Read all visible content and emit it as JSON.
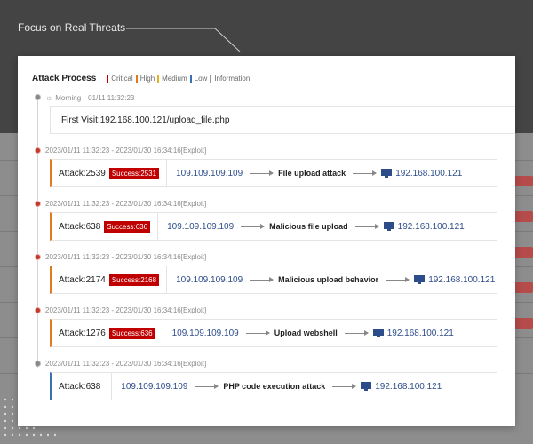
{
  "callout": {
    "text": "Focus on Real Threats"
  },
  "panel": {
    "title": "Attack Process",
    "legend": [
      {
        "label": "Critical",
        "color": "#c00000"
      },
      {
        "label": "High",
        "color": "#e07a1f"
      },
      {
        "label": "Medium",
        "color": "#e8b21f"
      },
      {
        "label": "Low",
        "color": "#3b6fb6"
      },
      {
        "label": "Information",
        "color": "#9a9a9a"
      }
    ]
  },
  "first_event": {
    "period": "Morning",
    "time": "01/11 11:32:23",
    "text": "First Visit:192.168.100.121/upload_file.php"
  },
  "events": [
    {
      "range": "2023/01/11 11:32:23 - 2023/01/30 16:34:16[Exploit]",
      "attack": "Attack:2539",
      "success": "Success:2531",
      "src_ip": "109.109.109.109",
      "name": "File upload attack",
      "dst_ip": "192.168.100.121",
      "level": "High"
    },
    {
      "range": "2023/01/11 11:32:23 - 2023/01/30 16:34:16[Exploit]",
      "attack": "Attack:638",
      "success": "Success:636",
      "src_ip": "109.109.109.109",
      "name": "Malicious file upload",
      "dst_ip": "192.168.100.121",
      "level": "High"
    },
    {
      "range": "2023/01/11 11:32:23 - 2023/01/30 16:34:16[Exploit]",
      "attack": "Attack:2174",
      "success": "Success:2168",
      "src_ip": "109.109.109.109",
      "name": "Malicious upload behavior",
      "dst_ip": "192.168.100.121",
      "level": "High"
    },
    {
      "range": "2023/01/11 11:32:23 - 2023/01/30 16:34:16[Exploit]",
      "attack": "Attack:1276",
      "success": "Success:636",
      "src_ip": "109.109.109.109",
      "name": "Upload webshell",
      "dst_ip": "192.168.100.121",
      "level": "High"
    },
    {
      "range": "2023/01/11 11:32:23 - 2023/01/30 16:34:16[Exploit]",
      "attack": "Attack:638",
      "success": "",
      "src_ip": "109.109.109.109",
      "name": "PHP code execution attack",
      "dst_ip": "192.168.100.121",
      "level": "Low"
    }
  ]
}
